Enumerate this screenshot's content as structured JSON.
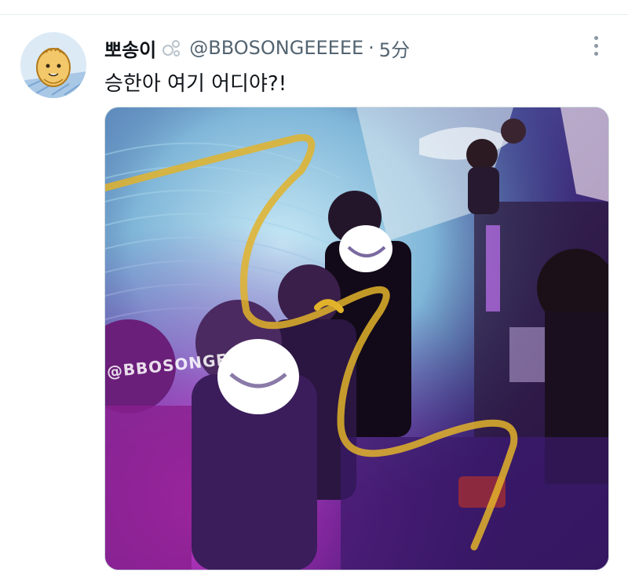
{
  "tweet": {
    "display_name": "뽀송이",
    "handle": "@BBOSONGEEEEE",
    "separator": "·",
    "time": "5分",
    "text": "승한아 여기 어디야?!"
  },
  "media": {
    "watermark": "@BBOSONGEEEEE"
  },
  "colors": {
    "text_primary": "#0f1419",
    "text_secondary": "#536471",
    "divider": "#e6ecf0",
    "scribble_yellow": "#e2b32a"
  },
  "icons": {
    "more": "more-vertical-icon",
    "name_badge": "bubbles-icon"
  }
}
